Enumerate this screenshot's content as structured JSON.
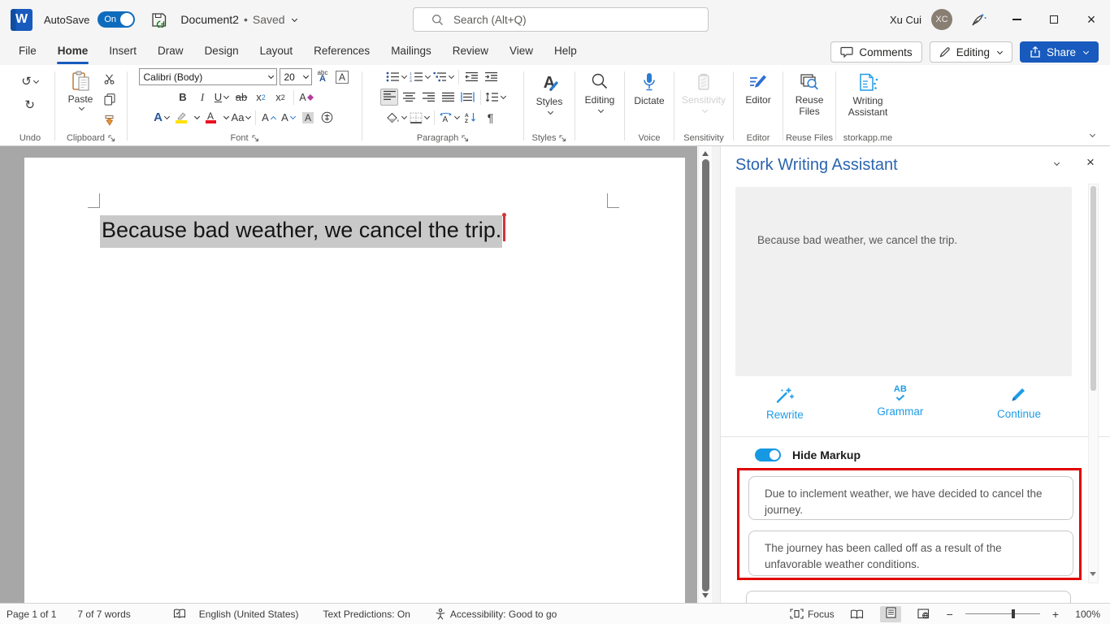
{
  "colors": {
    "accent_blue": "#185abd",
    "stork_blue": "#1e9ce8",
    "panel_title_blue": "#2b64ad",
    "annotation_red": "#e00202",
    "selection_gray": "#c9c9c9",
    "toggle_blue": "#1798e3"
  },
  "icons": {
    "word_w": "W",
    "close": "×",
    "undo": "↺",
    "redo": "↻",
    "bold": "B",
    "italic": "I",
    "underline": "U",
    "strike": "ab",
    "sub_x": "x",
    "sup_x": "x",
    "digit_two": "2",
    "clear_format": "A",
    "phonetic_abc": "abc",
    "phonetic_a": "A",
    "char_border_a": "A",
    "text_effect_a": "A",
    "font_color_a": "A",
    "case_aa": "Aa",
    "grow_a": "A",
    "shrink_a": "A",
    "char_shade_a": "A",
    "pilcrow": "¶",
    "grammar_ab": "AB",
    "minus": "−",
    "plus": "+"
  },
  "titlebar": {
    "autosave_label": "AutoSave",
    "autosave_state": "On",
    "doc_name": "Document2",
    "doc_sep": "•",
    "doc_status": "Saved",
    "search_placeholder": "Search (Alt+Q)",
    "user_name": "Xu Cui",
    "user_initials": "XC"
  },
  "tabs": {
    "items": [
      {
        "label": "File"
      },
      {
        "label": "Home"
      },
      {
        "label": "Insert"
      },
      {
        "label": "Draw"
      },
      {
        "label": "Design"
      },
      {
        "label": "Layout"
      },
      {
        "label": "References"
      },
      {
        "label": "Mailings"
      },
      {
        "label": "Review"
      },
      {
        "label": "View"
      },
      {
        "label": "Help"
      }
    ],
    "active": "Home",
    "comments": "Comments",
    "editing": "Editing",
    "share": "Share"
  },
  "ribbon": {
    "undo_group": "Undo",
    "paste": "Paste",
    "clipboard_group": "Clipboard",
    "font_name": "Calibri (Body)",
    "font_size": "20",
    "font_group": "Font",
    "paragraph_group": "Paragraph",
    "styles": "Styles",
    "styles_group": "Styles",
    "editing": "Editing",
    "dictate": "Dictate",
    "voice_group": "Voice",
    "sensitivity": "Sensitivity",
    "sensitivity_group": "Sensitivity",
    "editor": "Editor",
    "editor_group": "Editor",
    "reuse_line1": "Reuse",
    "reuse_line2": "Files",
    "reuse_group": "Reuse Files",
    "assistant_line1": "Writing",
    "assistant_line2": "Assistant",
    "assistant_group": "storkapp.me"
  },
  "document": {
    "text": "Because bad weather, we cancel the trip."
  },
  "panel": {
    "title": "Stork Writing Assistant",
    "input_text": "Because bad weather, we cancel the trip.",
    "actions": [
      {
        "label": "Rewrite"
      },
      {
        "label": "Grammar"
      },
      {
        "label": "Continue"
      }
    ],
    "toggle_label": "Hide Markup",
    "suggestions": [
      {
        "text": "Due to inclement weather, we have decided to cancel the journey."
      },
      {
        "text": "The journey has been called off as a result of the unfavorable weather conditions."
      }
    ]
  },
  "statusbar": {
    "page": "Page 1 of 1",
    "words": "7 of 7 words",
    "language": "English (United States)",
    "predictions": "Text Predictions: On",
    "accessibility": "Accessibility: Good to go",
    "focus": "Focus",
    "zoom_level": "100%"
  }
}
